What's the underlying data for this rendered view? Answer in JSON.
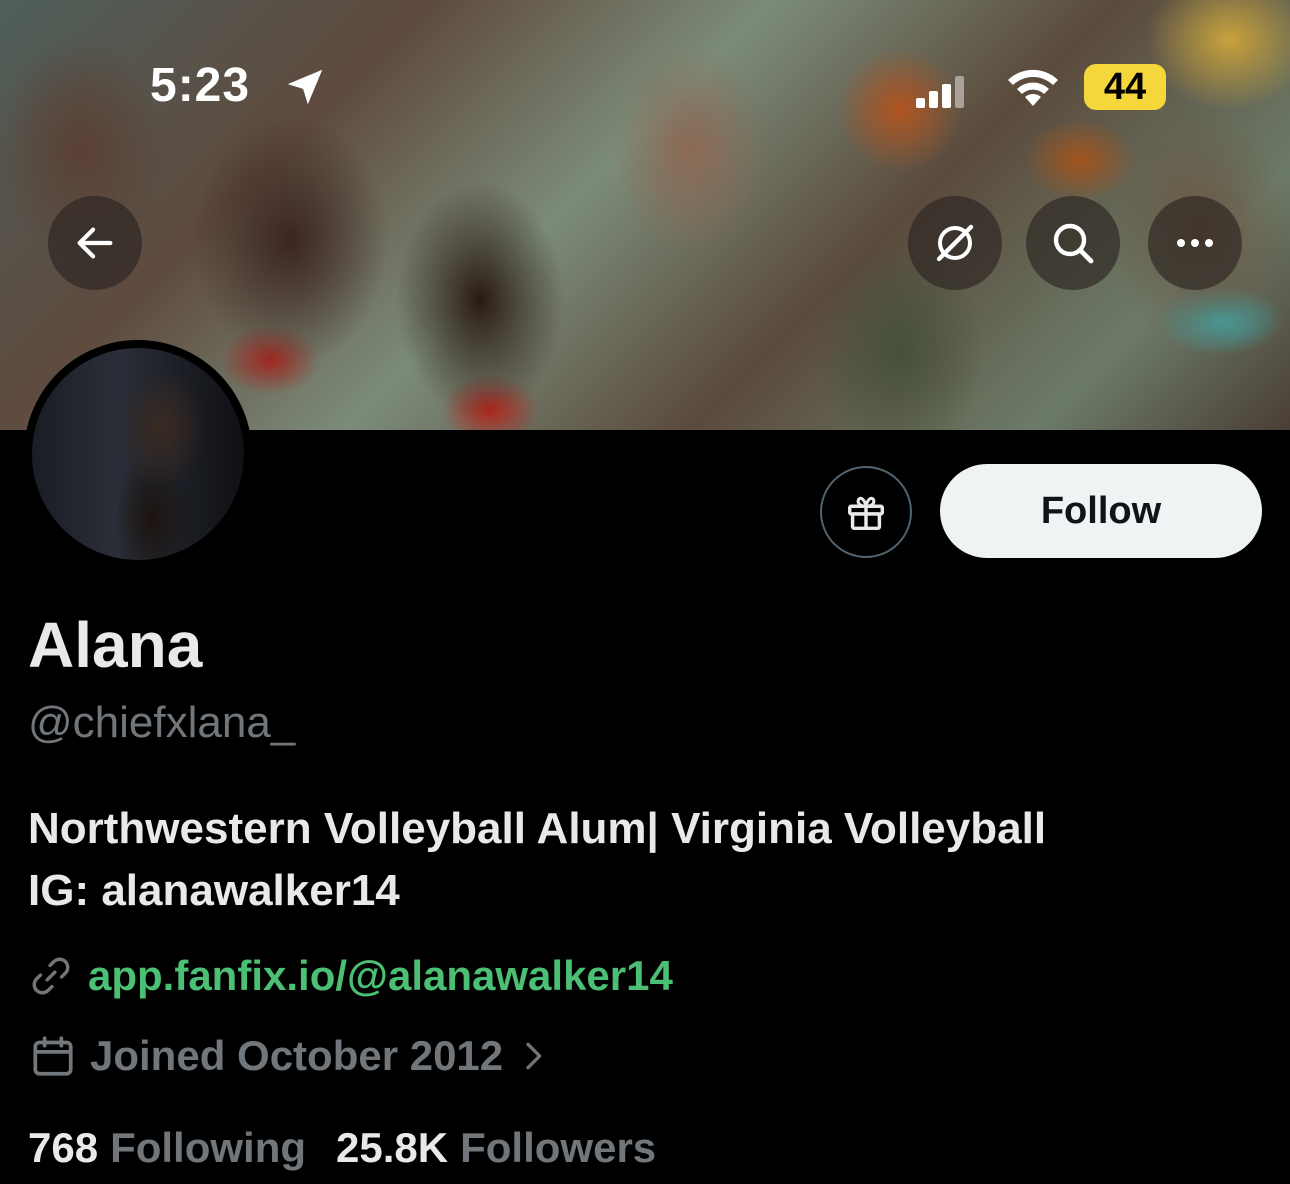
{
  "status_bar": {
    "time": "5:23",
    "battery": "44"
  },
  "header": {
    "back_icon": "arrow-left-icon",
    "grok_icon": "slash-circle-icon",
    "search_icon": "search-icon",
    "more_icon": "more-horizontal-icon"
  },
  "profile": {
    "name": "Alana",
    "handle": "@chiefxlana_",
    "bio_lines": [
      "Northwestern Volleyball Alum| Virginia Volleyball",
      "IG: alanawalker14"
    ],
    "link": "app.fanfix.io/@alanawalker14",
    "joined": "Joined October 2012",
    "following_count": "768",
    "following_label": "Following",
    "followers_count": "25.8K",
    "followers_label": "Followers"
  },
  "actions": {
    "follow_label": "Follow",
    "gift_icon": "gift-icon"
  },
  "colors": {
    "link": "#4bbf73",
    "muted": "#71767b",
    "battery": "#f5d73b"
  }
}
